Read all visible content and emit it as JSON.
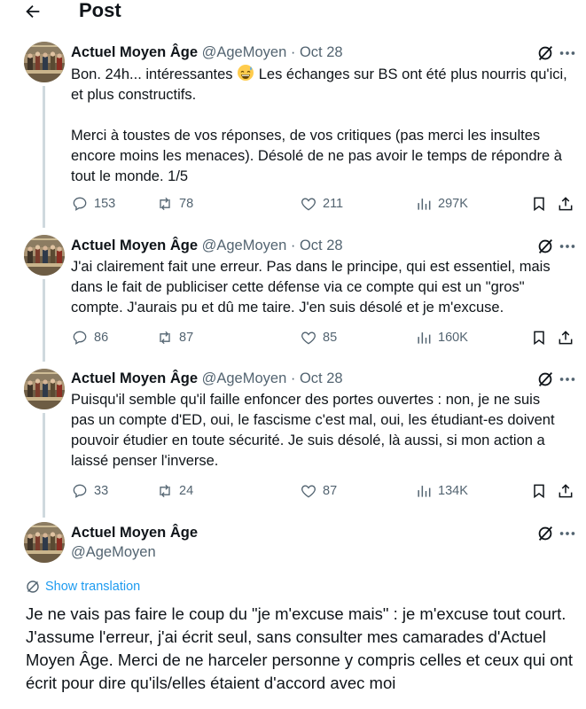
{
  "header": {
    "title": "Post",
    "back_icon": "arrow-left-icon"
  },
  "colors": {
    "text": "#0f1419",
    "secondary": "#536471",
    "link": "#1d9bf0",
    "thread_line": "#cfd9de"
  },
  "tweets": [
    {
      "name": "Actuel Moyen Âge",
      "handle": "@AgeMoyen",
      "dot": "·",
      "date": "Oct 28",
      "paragraphs": [
        {
          "text": "Bon. 24h... intéressantes",
          "emoji": "grinning-sweat-emoji",
          "text_after": "Les échanges sur BS ont été plus nourris qu'ici, et plus constructifs."
        },
        {
          "text": "Merci à toustes de vos réponses, de vos critiques (pas merci les insultes encore moins les menaces). Désolé de ne pas avoir le temps de répondre à tout le monde. 1/5"
        }
      ],
      "stats": {
        "replies": "153",
        "reposts": "78",
        "likes": "211",
        "views": "297K"
      }
    },
    {
      "name": "Actuel Moyen Âge",
      "handle": "@AgeMoyen",
      "dot": "·",
      "date": "Oct 28",
      "text": "J'ai clairement fait une erreur. Pas dans le principe, qui est essentiel, mais dans le fait de publiciser cette défense via ce compte qui est un \"gros\" compte. J'aurais pu et dû me taire. J'en suis désolé et je m'excuse.",
      "stats": {
        "replies": "86",
        "reposts": "87",
        "likes": "85",
        "views": "160K"
      }
    },
    {
      "name": "Actuel Moyen Âge",
      "handle": "@AgeMoyen",
      "dot": "·",
      "date": "Oct 28",
      "text": "Puisqu'il semble qu'il faille enfoncer des portes ouvertes : non, je ne suis pas un compte d'ED, oui, le fascisme c'est mal, oui, les étudiant-es doivent pouvoir étudier en toute sécurité. Je suis désolé, là aussi, si mon action a laissé penser l'inverse.",
      "stats": {
        "replies": "33",
        "reposts": "24",
        "likes": "87",
        "views": "134K"
      }
    }
  ],
  "main_tweet": {
    "name": "Actuel Moyen Âge",
    "handle": "@AgeMoyen",
    "translate_label": "Show translation",
    "text": "Je ne vais pas faire le coup du \"je m'excuse mais\" : je m'excuse tout court. J'assume l'erreur, j'ai écrit seul, sans consulter mes camarades d'Actuel Moyen Âge.  Merci de ne harceler personne y compris celles et ceux qui ont écrit pour dire qu'ils/elles étaient d'accord avec moi"
  }
}
